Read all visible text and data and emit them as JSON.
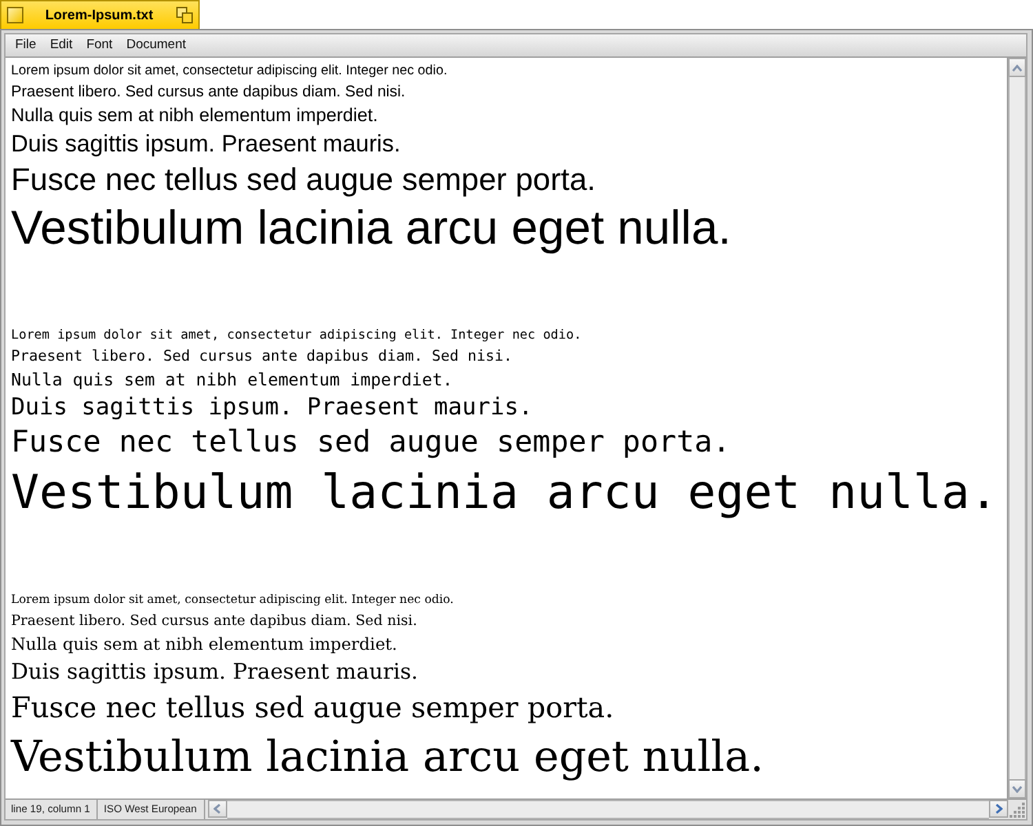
{
  "window": {
    "title": "Lorem-Ipsum.txt"
  },
  "menu_bar": [
    "File",
    "Edit",
    "Font",
    "Document"
  ],
  "document": {
    "blocks": [
      {
        "kind": "sans",
        "lines": [
          "Lorem ipsum dolor sit amet, consectetur adipiscing elit. Integer nec odio.",
          "Praesent libero. Sed cursus ante dapibus diam. Sed nisi.",
          "Nulla quis sem at nibh elementum imperdiet.",
          "Duis sagittis ipsum. Praesent mauris.",
          "Fusce nec tellus sed augue semper porta.",
          "Vestibulum lacinia arcu eget nulla."
        ]
      },
      {
        "kind": "mono",
        "lines": [
          "Lorem ipsum dolor sit amet, consectetur adipiscing elit. Integer nec odio.",
          "Praesent libero. Sed cursus ante dapibus diam. Sed nisi.",
          "Nulla quis sem at nibh elementum imperdiet.",
          "Duis sagittis ipsum. Praesent mauris.",
          "Fusce nec tellus sed augue semper porta.",
          "Vestibulum lacinia arcu eget nulla."
        ]
      },
      {
        "kind": "serif",
        "lines": [
          "Lorem ipsum dolor sit amet, consectetur adipiscing elit. Integer nec odio.",
          "Praesent libero. Sed cursus ante dapibus diam. Sed nisi.",
          "Nulla quis sem at nibh elementum imperdiet.",
          "Duis sagittis ipsum. Praesent mauris.",
          "Fusce nec tellus sed augue semper porta.",
          "Vestibulum lacinia arcu eget nulla."
        ]
      }
    ]
  },
  "status_bar": {
    "position": "line 19, column 1",
    "encoding": "ISO West European"
  }
}
